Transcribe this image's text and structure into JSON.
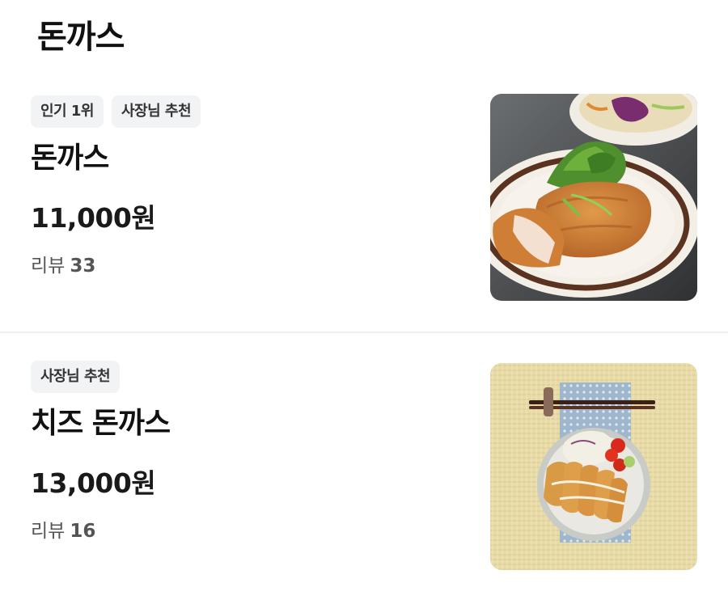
{
  "section": {
    "title": "돈까스"
  },
  "menu_items": [
    {
      "badges": [
        "인기 1위",
        "사장님 추천"
      ],
      "name": "돈까스",
      "price": "11,000원",
      "reviews_label": "리뷰",
      "reviews_count": "33",
      "image": "tonkatsu-plate-photo"
    },
    {
      "badges": [
        "사장님 추천"
      ],
      "name": "치즈 돈까스",
      "price": "13,000원",
      "reviews_label": "리뷰",
      "reviews_count": "16",
      "image": "cheese-tonkatsu-plate-photo"
    }
  ],
  "colors": {
    "badge_bg": "#f2f3f5",
    "text_primary": "#111111",
    "text_secondary": "#555555",
    "divider": "#efefef"
  }
}
